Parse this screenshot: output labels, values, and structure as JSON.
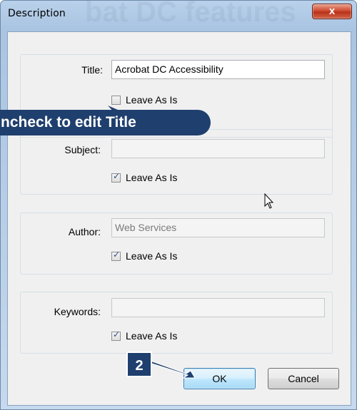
{
  "window": {
    "title": "Description",
    "ghost_text": "bat DC features",
    "close_glyph": "x"
  },
  "fields": [
    {
      "label": "Title:",
      "value": "Acrobat DC Accessibility",
      "disabled": false,
      "leave_as_is": false
    },
    {
      "label": "Subject:",
      "value": "",
      "disabled": true,
      "leave_as_is": true
    },
    {
      "label": "Author:",
      "value": "Web Services",
      "disabled": true,
      "leave_as_is": true
    },
    {
      "label": "Keywords:",
      "value": "",
      "disabled": true,
      "leave_as_is": true
    }
  ],
  "checkbox_label": "Leave As Is",
  "annotations": {
    "callout_text": "ncheck to edit Title",
    "step_badge": "2"
  },
  "buttons": {
    "ok": "OK",
    "cancel": "Cancel"
  },
  "colors": {
    "callout_bg": "#1f3f6e",
    "close_red": "#c9432a"
  }
}
